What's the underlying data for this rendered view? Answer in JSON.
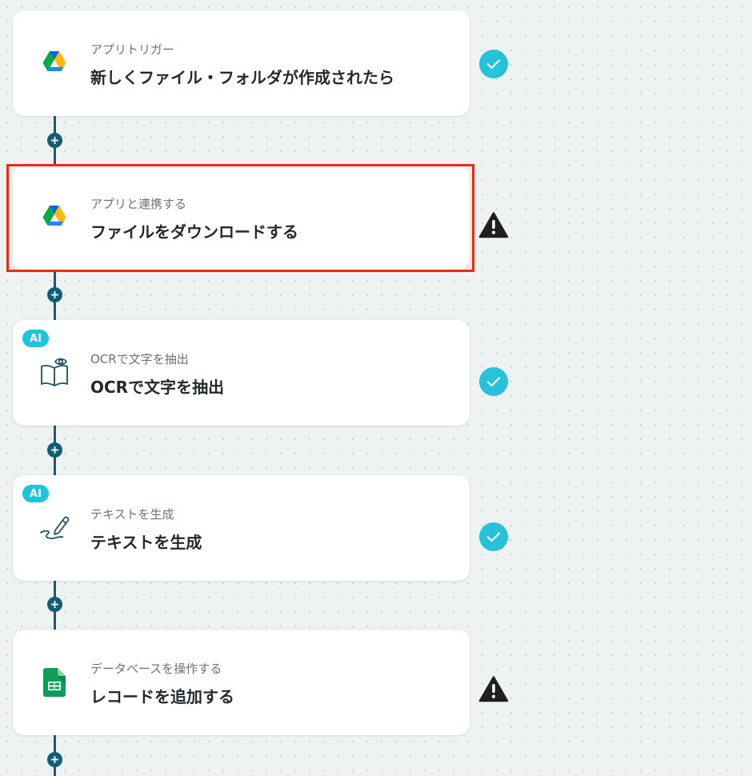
{
  "flow": {
    "steps": [
      {
        "subtitle": "アプリトリガー",
        "title": "新しくファイル・フォルダが作成されたら",
        "icon": "google-drive-icon",
        "status": "complete",
        "ai": false
      },
      {
        "subtitle": "アプリと連携する",
        "title": "ファイルをダウンロードする",
        "icon": "google-drive-icon",
        "status": "warning",
        "ai": false,
        "highlighted": true
      },
      {
        "subtitle": "OCRで文字を抽出",
        "title": "OCRで文字を抽出",
        "icon": "ocr-book-icon",
        "status": "complete",
        "ai": true,
        "ai_label": "AI"
      },
      {
        "subtitle": "テキストを生成",
        "title": "テキストを生成",
        "icon": "pen-icon",
        "status": "complete",
        "ai": true,
        "ai_label": "AI"
      },
      {
        "subtitle": "データベースを操作する",
        "title": "レコードを追加する",
        "icon": "google-sheets-icon",
        "status": "warning",
        "ai": false
      }
    ]
  },
  "colors": {
    "connector": "#0f5e73",
    "check": "#25c2da",
    "ai_badge": "#1ec3dc",
    "warning": "#1f1f1f",
    "highlight": "#ee2a10"
  }
}
